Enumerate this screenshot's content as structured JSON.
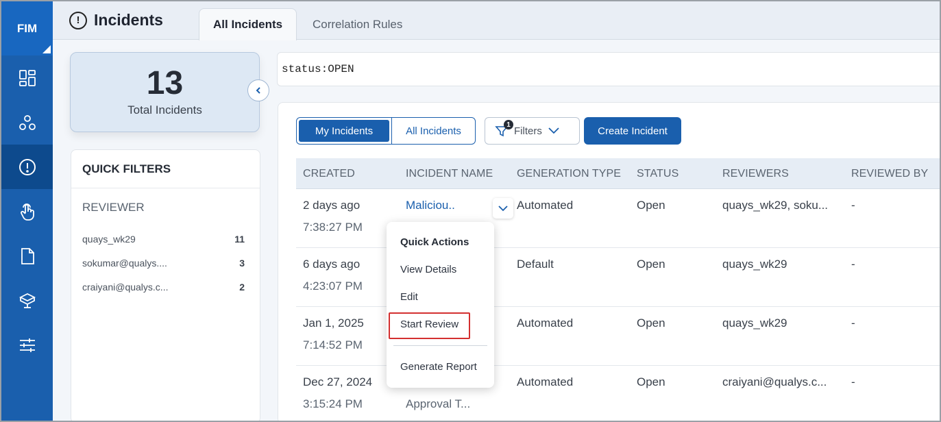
{
  "brand": "FIM",
  "header": {
    "title": "Incidents",
    "tabs": [
      {
        "label": "All Incidents",
        "active": true
      },
      {
        "label": "Correlation Rules",
        "active": false
      }
    ]
  },
  "sidebar": {
    "items": [
      {
        "icon": "dashboard-icon",
        "active": false
      },
      {
        "icon": "assets-icon",
        "active": false
      },
      {
        "icon": "incidents-icon",
        "active": true
      },
      {
        "icon": "touch-icon",
        "active": false
      },
      {
        "icon": "document-icon",
        "active": false
      },
      {
        "icon": "agent-icon",
        "active": false
      },
      {
        "icon": "sliders-icon",
        "active": false
      }
    ]
  },
  "summary": {
    "count": "13",
    "label": "Total Incidents"
  },
  "quick_filters": {
    "title": "QUICK FILTERS",
    "section": "REVIEWER",
    "items": [
      {
        "label": "quays_wk29",
        "count": "11"
      },
      {
        "label": "sokumar@qualys....",
        "count": "3"
      },
      {
        "label": "craiyani@qualys.c...",
        "count": "2"
      }
    ]
  },
  "search": {
    "value": "status:OPEN"
  },
  "toolbar": {
    "my_incidents": "My Incidents",
    "all_incidents": "All Incidents",
    "filters_label": "Filters",
    "filters_count": "1",
    "create_incident": "Create Incident"
  },
  "table": {
    "columns": [
      "CREATED",
      "INCIDENT NAME",
      "GENERATION TYPE",
      "STATUS",
      "REVIEWERS",
      "REVIEWED BY"
    ],
    "rows": [
      {
        "created_day": "2 days ago",
        "created_time": "7:38:27 PM",
        "name": "Maliciou..",
        "name_sub": "",
        "generation": "Automated",
        "status": "Open",
        "reviewers": "quays_wk29, soku...",
        "reviewed_by": "-"
      },
      {
        "created_day": "6 days ago",
        "created_time": "4:23:07 PM",
        "name": "",
        "name_sub": "",
        "generation": "Default",
        "status": "Open",
        "reviewers": "quays_wk29",
        "reviewed_by": "-"
      },
      {
        "created_day": "Jan 1, 2025",
        "created_time": "7:14:52 PM",
        "name": "",
        "name_sub": "",
        "generation": "Automated",
        "status": "Open",
        "reviewers": "quays_wk29",
        "reviewed_by": "-"
      },
      {
        "created_day": "Dec 27, 2024",
        "created_time": "3:15:24 PM",
        "name": "",
        "name_sub": "Approval T...",
        "generation": "Automated",
        "status": "Open",
        "reviewers": "craiyani@qualys.c...",
        "reviewed_by": "-"
      }
    ]
  },
  "quick_actions": {
    "title": "Quick Actions",
    "items": [
      "View Details",
      "Edit",
      "Start Review",
      "Generate Report"
    ]
  }
}
